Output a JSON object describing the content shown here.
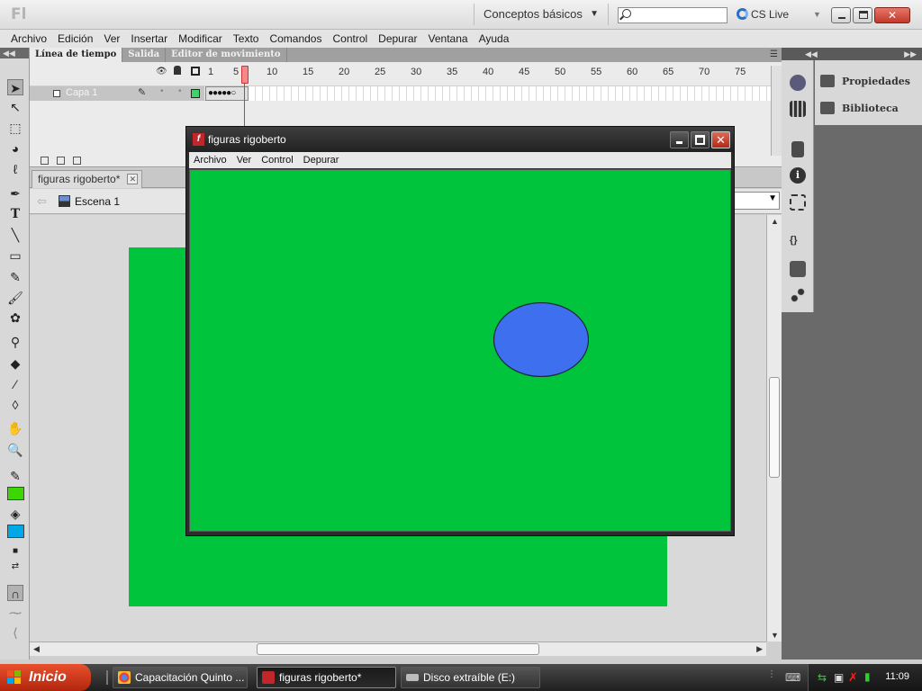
{
  "app": {
    "logo": "Fl",
    "workspace": "Conceptos básicos",
    "cs_live": "CS Live"
  },
  "menu": [
    "Archivo",
    "Edición",
    "Ver",
    "Insertar",
    "Modificar",
    "Texto",
    "Comandos",
    "Control",
    "Depurar",
    "Ventana",
    "Ayuda"
  ],
  "timeline": {
    "tabs": [
      "Línea de tiempo",
      "Salida",
      "Editor de movimiento"
    ],
    "ruler_labels": [
      "1",
      "5",
      "10",
      "15",
      "20",
      "25",
      "30",
      "35",
      "40",
      "45",
      "50",
      "55",
      "60",
      "65",
      "70",
      "75"
    ],
    "layer_name": "Capa 1",
    "current_frame": 6,
    "keyframes": "●●●●●○"
  },
  "document": {
    "tab_title": "figuras rigoberto*",
    "scene": "Escena 1",
    "stage_color": "#00c43c"
  },
  "right_panels": [
    {
      "label": "Propiedades",
      "icon": "properties-icon"
    },
    {
      "label": "Biblioteca",
      "icon": "library-icon"
    }
  ],
  "tools": {
    "stroke_color": "#3cd600",
    "fill_color": "#00a8e8"
  },
  "preview": {
    "title": "figuras rigoberto",
    "menu": [
      "Archivo",
      "Ver",
      "Control",
      "Depurar"
    ],
    "bg_color": "#00c43c",
    "ellipse_fill": "#3d6fef",
    "ellipse_stroke": "#1e2a3a"
  },
  "taskbar": {
    "start": "Inicio",
    "tasks": [
      {
        "label": "Capacitación Quinto ...",
        "icon": "chrome-icon",
        "active": false
      },
      {
        "label": "figuras rigoberto*",
        "icon": "flash-icon",
        "active": true
      },
      {
        "label": "Disco extraíble (E:)",
        "icon": "drive-icon",
        "active": false
      }
    ],
    "clock": "11:09"
  }
}
